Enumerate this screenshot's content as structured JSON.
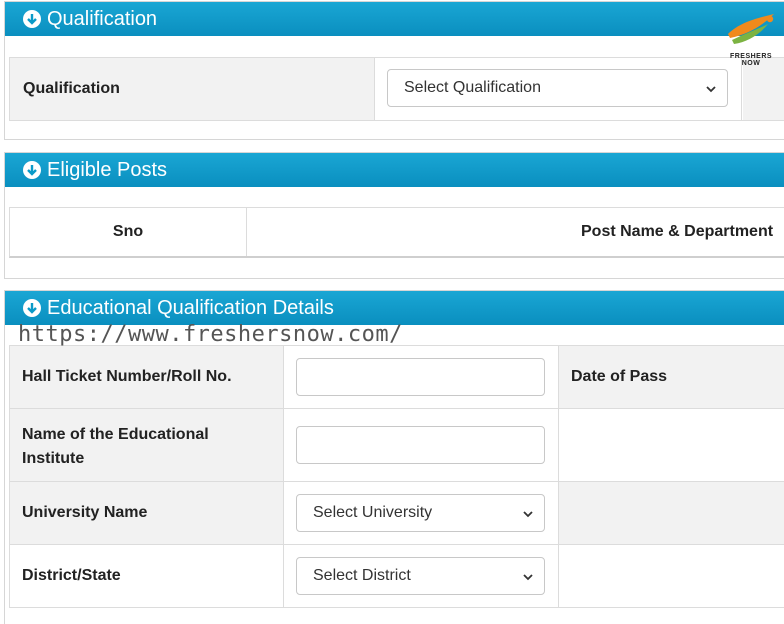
{
  "qualification_panel": {
    "title": "Qualification",
    "field_label": "Qualification",
    "select_value": "Select Qualification"
  },
  "logo": {
    "text": "FRESHERS NOW"
  },
  "eligible_panel": {
    "title": "Eligible Posts",
    "columns": [
      "Sno",
      "Post Name & Department"
    ]
  },
  "education_panel": {
    "title": "Educational Qualification Details",
    "watermark": "https://www.freshersnow.com/",
    "rows": {
      "hall_ticket": "Hall Ticket Number/Roll No.",
      "date_of_pass": "Date of Pass",
      "institute_line1": "Name of the Educational",
      "institute_line2": "Institute",
      "university": "University Name",
      "university_select": "Select University",
      "district": "District/State",
      "district_select": "Select District"
    }
  },
  "colors": {
    "header": "#0a9ac8",
    "label_bg": "#f2f2f2"
  }
}
